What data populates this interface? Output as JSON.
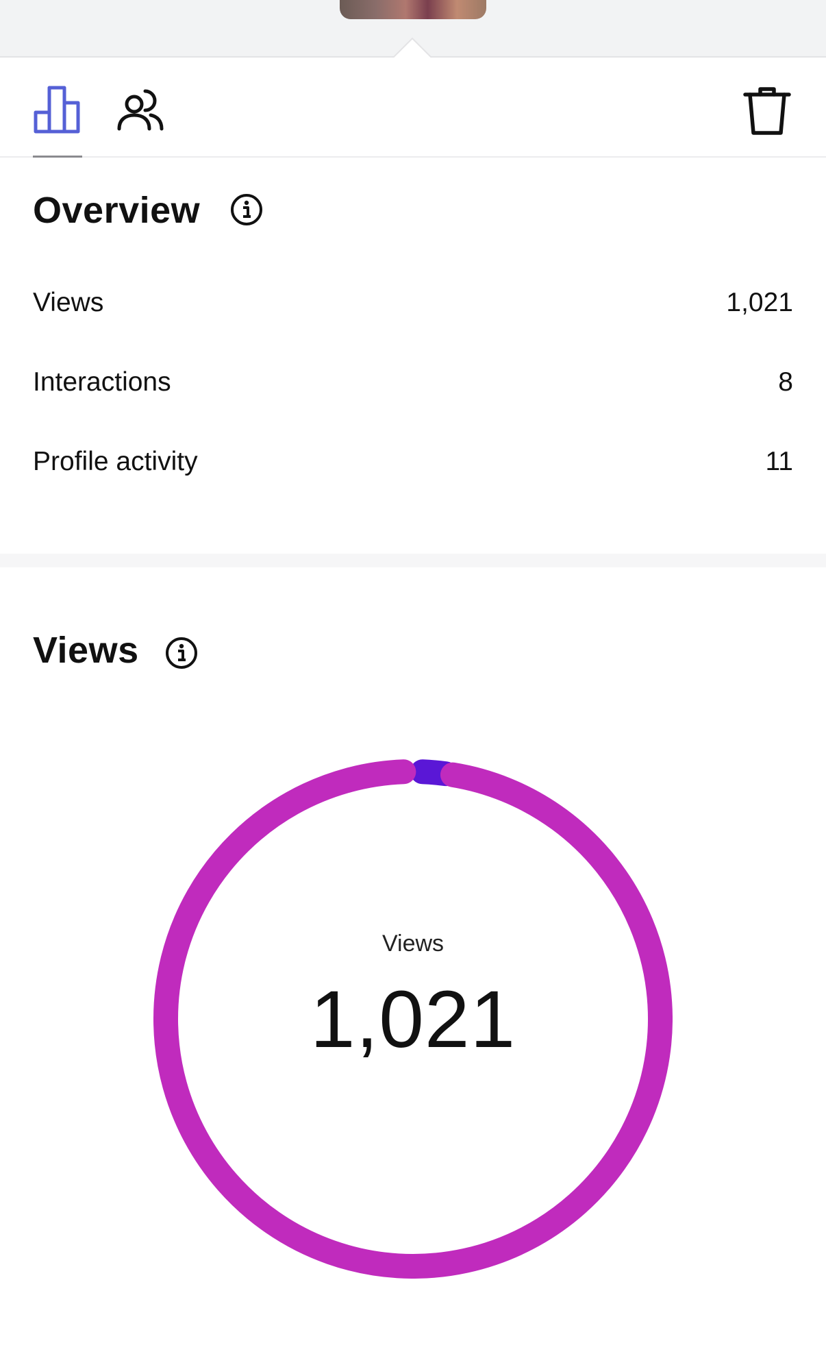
{
  "tabs": {
    "insights_icon": "bar-chart-icon",
    "audience_icon": "people-icon",
    "delete_icon": "trash-icon",
    "active_color": "#5560d6"
  },
  "overview": {
    "title": "Overview",
    "rows": [
      {
        "label": "Views",
        "value": "1,021"
      },
      {
        "label": "Interactions",
        "value": "8"
      },
      {
        "label": "Profile activity",
        "value": "11"
      }
    ]
  },
  "views": {
    "title": "Views",
    "donut_label": "Views",
    "donut_value": "1,021",
    "colors": {
      "primary": "#c02bbd",
      "secondary": "#5a17d6"
    },
    "split": {
      "major_fraction": 0.985,
      "minor_fraction": 0.015
    }
  }
}
